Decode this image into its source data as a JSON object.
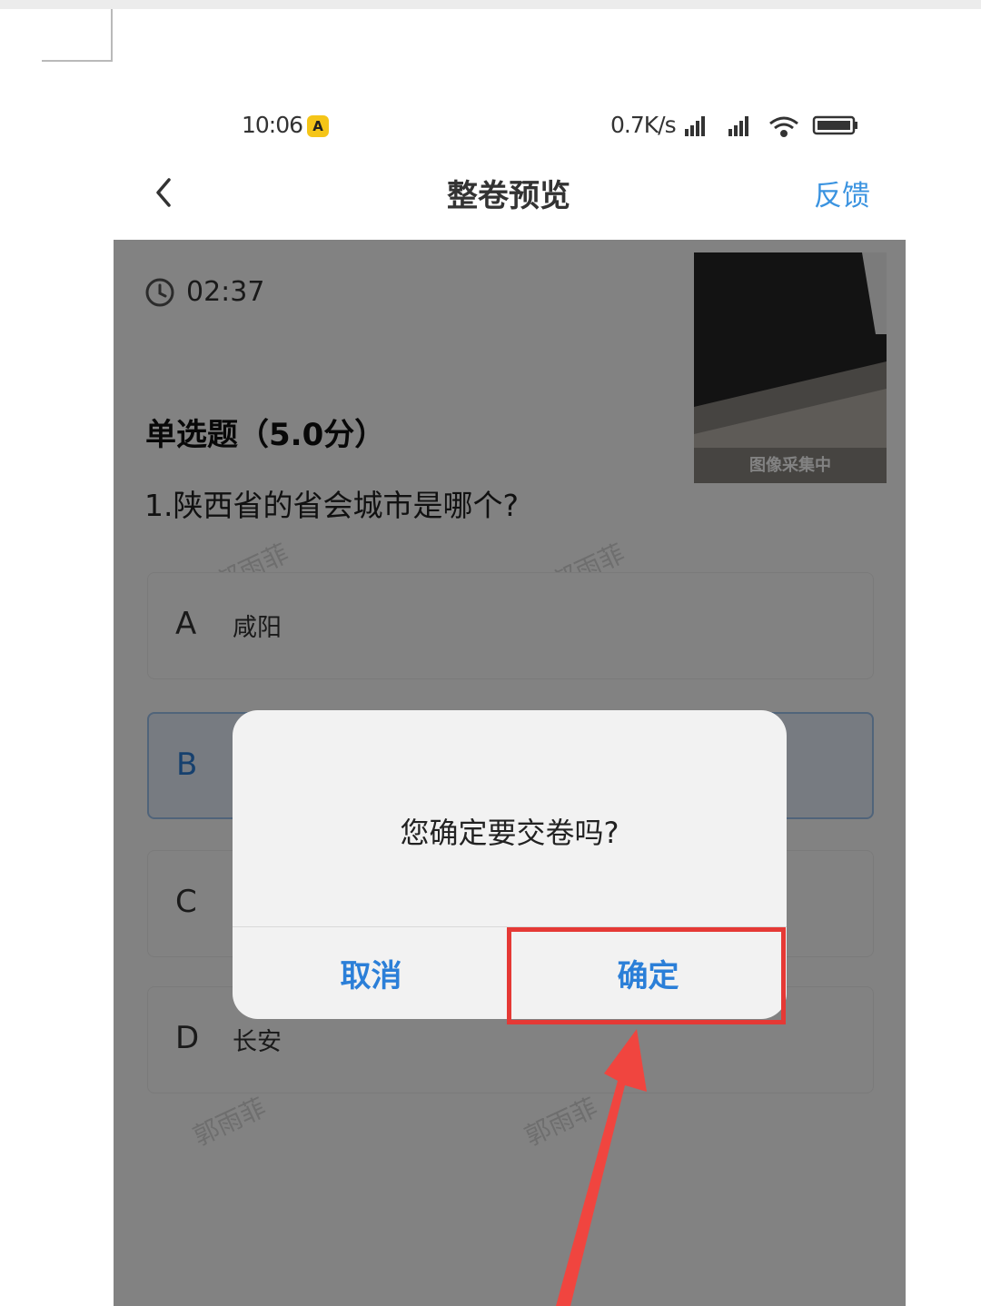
{
  "status_bar": {
    "time": "10:06",
    "badge": "A",
    "network_speed": "0.7K/s",
    "icons": [
      "cellular-signal-icon",
      "cellular-signal-icon",
      "wifi-icon",
      "battery-icon"
    ]
  },
  "nav": {
    "title": "整卷预览",
    "feedback_label": "反馈"
  },
  "exam": {
    "timer": "02:37",
    "camera_label": "图像采集中",
    "question_type": "单选题（5.0分）",
    "question": "1.陕西省的省会城市是哪个?",
    "options": [
      {
        "letter": "A",
        "text": "咸阳"
      },
      {
        "letter": "B",
        "text": ""
      },
      {
        "letter": "C",
        "text": ""
      },
      {
        "letter": "D",
        "text": "长安"
      }
    ],
    "selected_option": "B",
    "watermark": "郭雨菲"
  },
  "dialog": {
    "message": "您确定要交卷吗?",
    "cancel_label": "取消",
    "confirm_label": "确定"
  },
  "colors": {
    "accent": "#2b7fd8",
    "feedback": "#3a93e0",
    "highlight": "#e53935",
    "overlay": "rgba(0,0,0,0.49)"
  }
}
